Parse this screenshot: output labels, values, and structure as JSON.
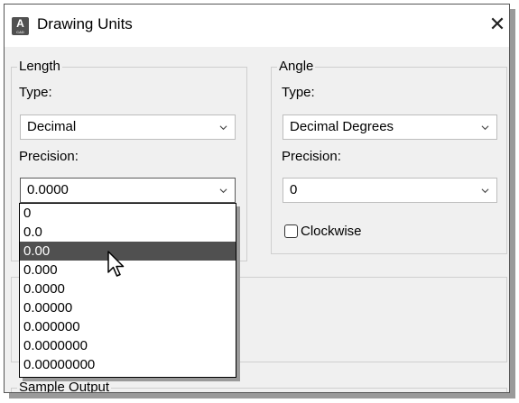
{
  "window": {
    "title": "Drawing Units",
    "app_icon_letter": "A",
    "app_icon_sub": "CAD",
    "close_glyph": "✕"
  },
  "length": {
    "group_label": "Length",
    "type_label": "Type:",
    "type_value": "Decimal",
    "precision_label": "Precision:",
    "precision_value": "0.0000",
    "precision_options": [
      "0",
      "0.0",
      "0.00",
      "0.000",
      "0.0000",
      "0.00000",
      "0.000000",
      "0.0000000",
      "0.00000000"
    ],
    "highlighted_option": "0.00"
  },
  "angle": {
    "group_label": "Angle",
    "type_label": "Type:",
    "type_value": "Decimal Degrees",
    "precision_label": "Precision:",
    "precision_value": "0",
    "clockwise_label": "Clockwise",
    "clockwise_checked": false
  },
  "sample_output": {
    "label": "Sample Output"
  },
  "colors": {
    "dialog_bg": "#f0f0f0",
    "highlight_bg": "#505050",
    "highlight_text": "#ffffff"
  }
}
